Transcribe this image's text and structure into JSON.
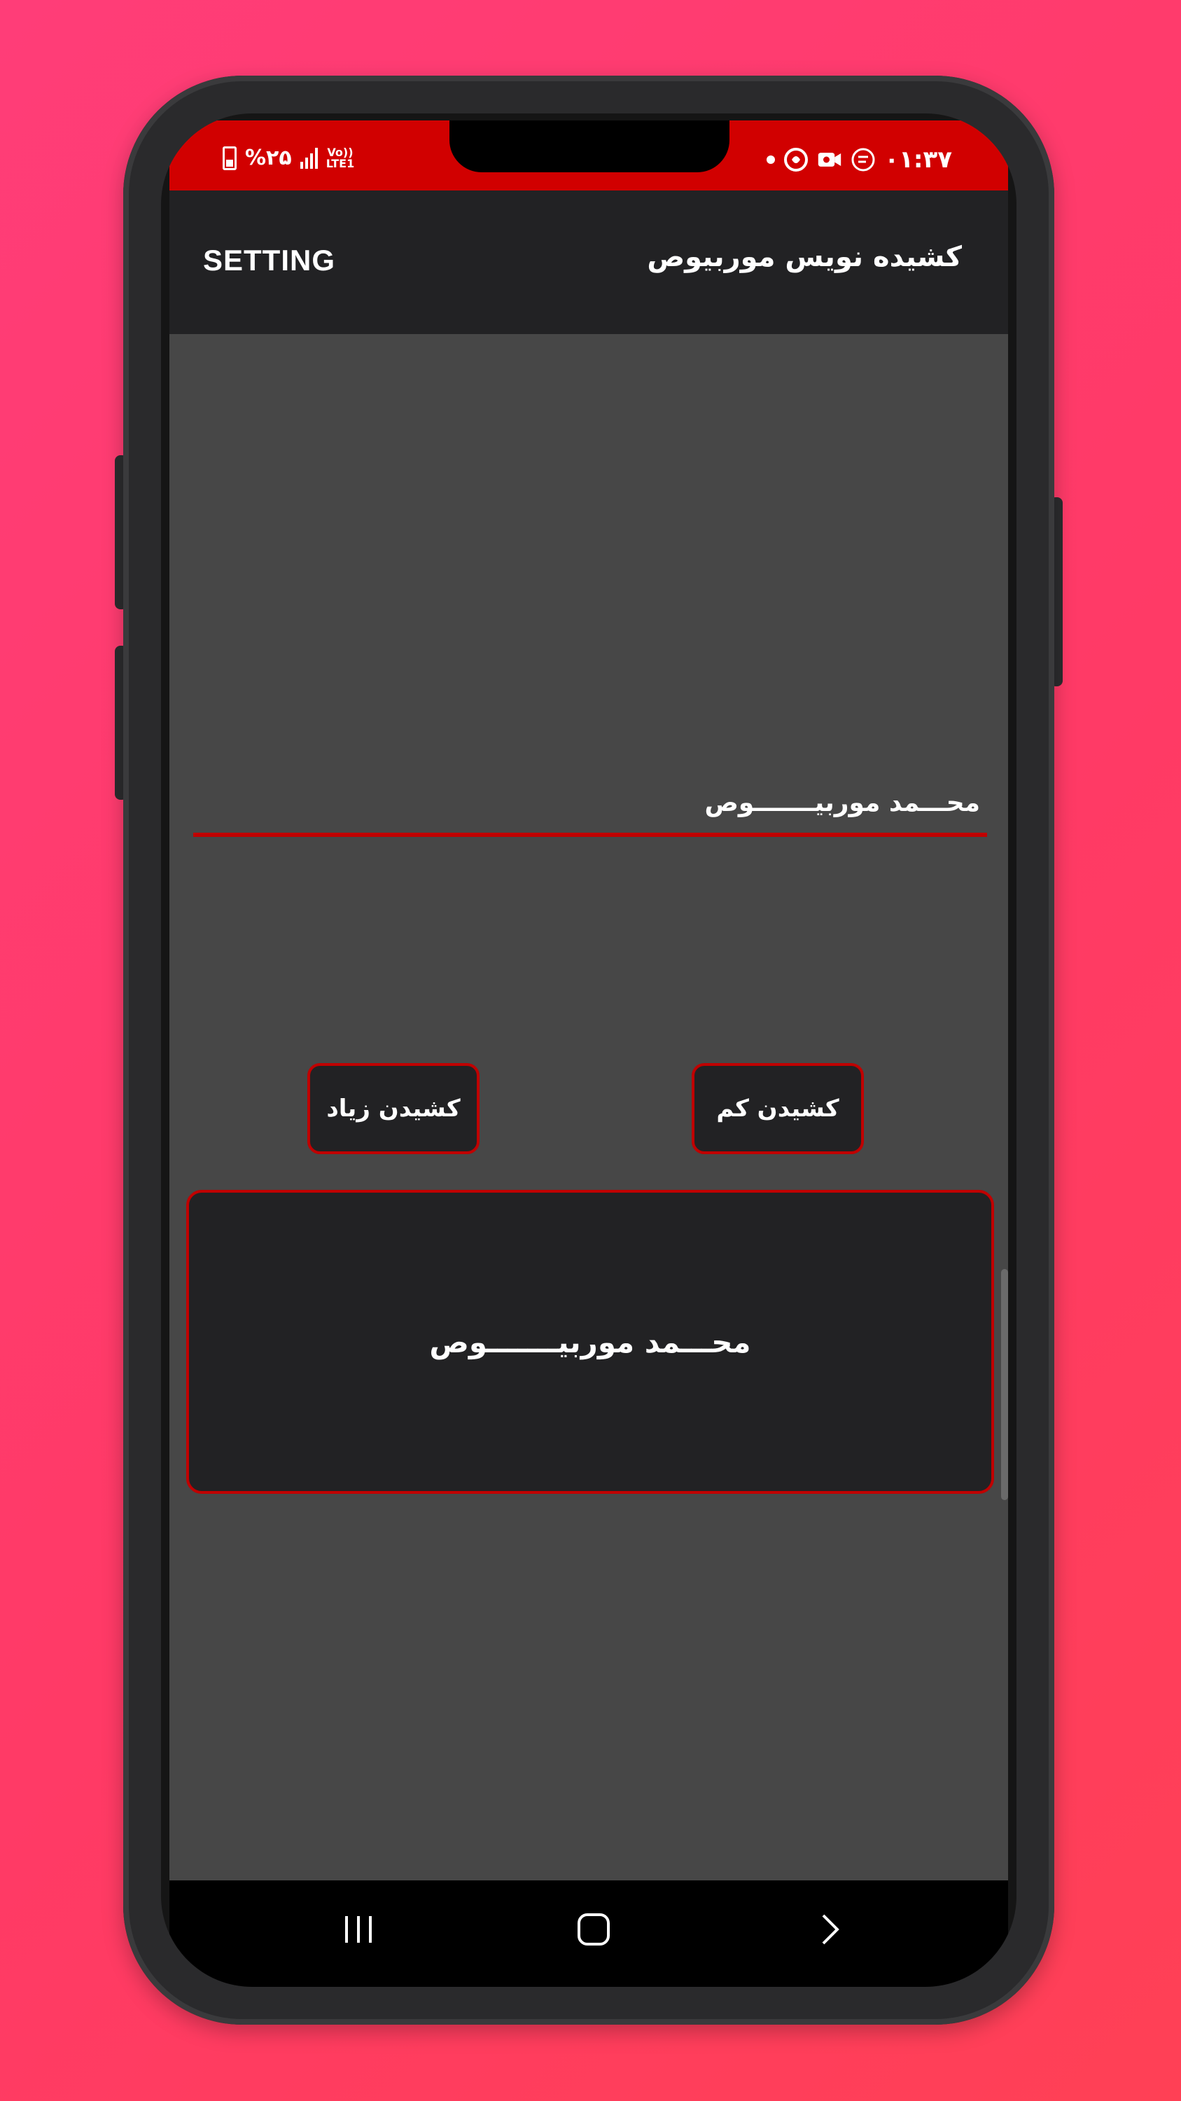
{
  "status_bar": {
    "time": "۰۱:۳۷",
    "battery_percent": "%۲۵",
    "network_label_top": "Vo))",
    "network_label_bottom": "LTE1",
    "icons": [
      "battery-icon",
      "signal-icon",
      "lte-icon",
      "dot-icon",
      "app-icon",
      "video-call-icon",
      "chat-icon"
    ]
  },
  "toolbar": {
    "title": "کشیده نویس موربیوص",
    "setting_label": "SETTING"
  },
  "input": {
    "value": "محـــمد موربیـــــــوص"
  },
  "buttons": {
    "decrease_label": "کشیدن کم",
    "increase_label": "کشیدن زیاد"
  },
  "result": {
    "text": "محـــمد موربیـــــــوص"
  },
  "nav_bar": {
    "icons": [
      "recent-apps-icon",
      "home-icon",
      "back-icon"
    ]
  },
  "colors": {
    "background_pink": "#ff3d70",
    "accent_red": "#d10000",
    "dark_surface": "#222224",
    "screen_background": "#474747"
  }
}
